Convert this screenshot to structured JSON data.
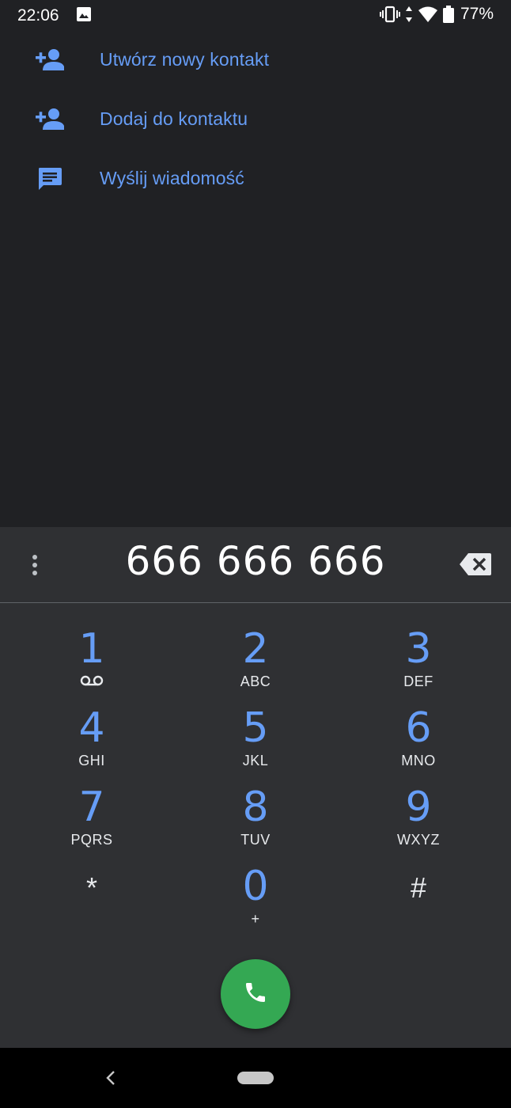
{
  "status_bar": {
    "time": "22:06",
    "battery_percent": "77%",
    "icons": [
      "image-icon",
      "vibrate-icon",
      "data-arrows-icon",
      "wifi-icon",
      "battery-icon"
    ]
  },
  "actions": [
    {
      "label": "Utwórz nowy kontakt",
      "icon": "person-add-icon"
    },
    {
      "label": "Dodaj do kontaktu",
      "icon": "person-add-icon"
    },
    {
      "label": "Wyślij wiadomość",
      "icon": "message-icon"
    }
  ],
  "dialpad": {
    "entered_number": "666 666 666",
    "keys": [
      {
        "digit": "1",
        "letters": "",
        "voicemail": true
      },
      {
        "digit": "2",
        "letters": "ABC"
      },
      {
        "digit": "3",
        "letters": "DEF"
      },
      {
        "digit": "4",
        "letters": "GHI"
      },
      {
        "digit": "5",
        "letters": "JKL"
      },
      {
        "digit": "6",
        "letters": "MNO"
      },
      {
        "digit": "7",
        "letters": "PQRS"
      },
      {
        "digit": "8",
        "letters": "TUV"
      },
      {
        "digit": "9",
        "letters": "WXYZ"
      },
      {
        "digit": "*",
        "letters": ""
      },
      {
        "digit": "0",
        "letters": "+"
      },
      {
        "digit": "#",
        "letters": ""
      }
    ]
  },
  "colors": {
    "background": "#202124",
    "dialpad_background": "#2f3033",
    "accent_blue": "#669df6",
    "call_green": "#34a853",
    "nav_bar": "#000000"
  }
}
